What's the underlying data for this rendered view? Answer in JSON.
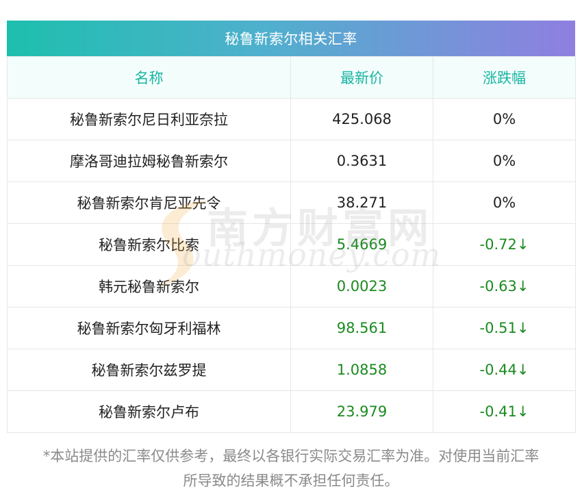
{
  "title": "秘鲁新索尔相关汇率",
  "columns": [
    "名称",
    "最新价",
    "涨跌幅"
  ],
  "rows": [
    {
      "name": "秘鲁新索尔尼日利亚奈拉",
      "price": "425.068",
      "change": "0%",
      "trend": "flat"
    },
    {
      "name": "摩洛哥迪拉姆秘鲁新索尔",
      "price": "0.3631",
      "change": "0%",
      "trend": "flat"
    },
    {
      "name": "秘鲁新索尔肯尼亚先令",
      "price": "38.271",
      "change": "0%",
      "trend": "flat"
    },
    {
      "name": "秘鲁新索尔比索",
      "price": "5.4669",
      "change": "-0.72↓",
      "trend": "down"
    },
    {
      "name": "韩元秘鲁新索尔",
      "price": "0.0023",
      "change": "-0.63↓",
      "trend": "down"
    },
    {
      "name": "秘鲁新索尔匈牙利福林",
      "price": "98.561",
      "change": "-0.51↓",
      "trend": "down"
    },
    {
      "name": "秘鲁新索尔兹罗提",
      "price": "1.0858",
      "change": "-0.44↓",
      "trend": "down"
    },
    {
      "name": "秘鲁新索尔卢布",
      "price": "23.979",
      "change": "-0.41↓",
      "trend": "down"
    }
  ],
  "watermark": {
    "cn": "南方财富网",
    "en": "outhmoney.com"
  },
  "footnote_line1": "*本站提供的汇率仅供参考，最终以各银行实际交易汇率为准。对使用当前汇率",
  "footnote_line2": "所导致的结果概不承担任何责任。",
  "colors": {
    "header_text": "#1ab4a3",
    "down": "#1a8a1f",
    "gradient_start": "#1dbfae",
    "gradient_end": "#8f7fe0"
  }
}
